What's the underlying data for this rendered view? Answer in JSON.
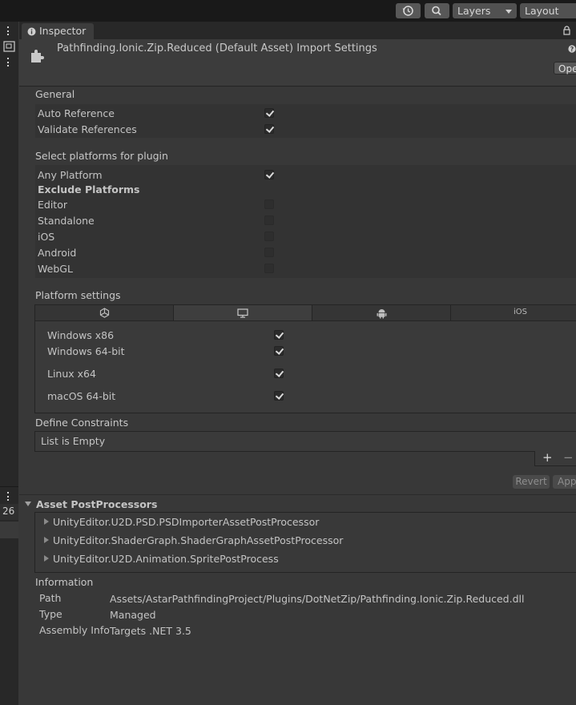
{
  "toolbar": {
    "layers": "Layers",
    "layout": "Layout"
  },
  "left_panel": {
    "count": "26"
  },
  "tab": {
    "title": "Inspector"
  },
  "header": {
    "title": "Pathfinding.Ionic.Zip.Reduced (Default Asset) Import Settings",
    "open_button": "Ope"
  },
  "general": {
    "title": "General",
    "auto_reference": "Auto Reference",
    "validate_references": "Validate References"
  },
  "platforms": {
    "title": "Select platforms for plugin",
    "any_platform": "Any Platform",
    "exclude_title": "Exclude Platforms",
    "items": [
      "Editor",
      "Standalone",
      "iOS",
      "Android",
      "WebGL"
    ]
  },
  "platform_settings": {
    "title": "Platform settings",
    "tab_ios": "iOS",
    "items": [
      "Windows x86",
      "Windows 64-bit",
      "Linux x64",
      "macOS 64-bit"
    ]
  },
  "define_constraints": {
    "title": "Define Constraints",
    "empty": "List is Empty",
    "add": "+",
    "remove": "−"
  },
  "actions": {
    "revert": "Revert",
    "apply": "App"
  },
  "postprocessors": {
    "title": "Asset PostProcessors",
    "items": [
      "UnityEditor.U2D.PSD.PSDImporterAssetPostProcessor",
      "UnityEditor.ShaderGraph.ShaderGraphAssetPostProcessor",
      "UnityEditor.U2D.Animation.SpritePostProcess"
    ]
  },
  "information": {
    "title": "Information",
    "path_label": "Path",
    "path_value": "Assets/AstarPathfindingProject/Plugins/DotNetZip/Pathfinding.Ionic.Zip.Reduced.dll",
    "type_label": "Type",
    "type_value": "Managed",
    "assembly_label": "Assembly Info",
    "assembly_value": "Targets .NET 3.5"
  }
}
